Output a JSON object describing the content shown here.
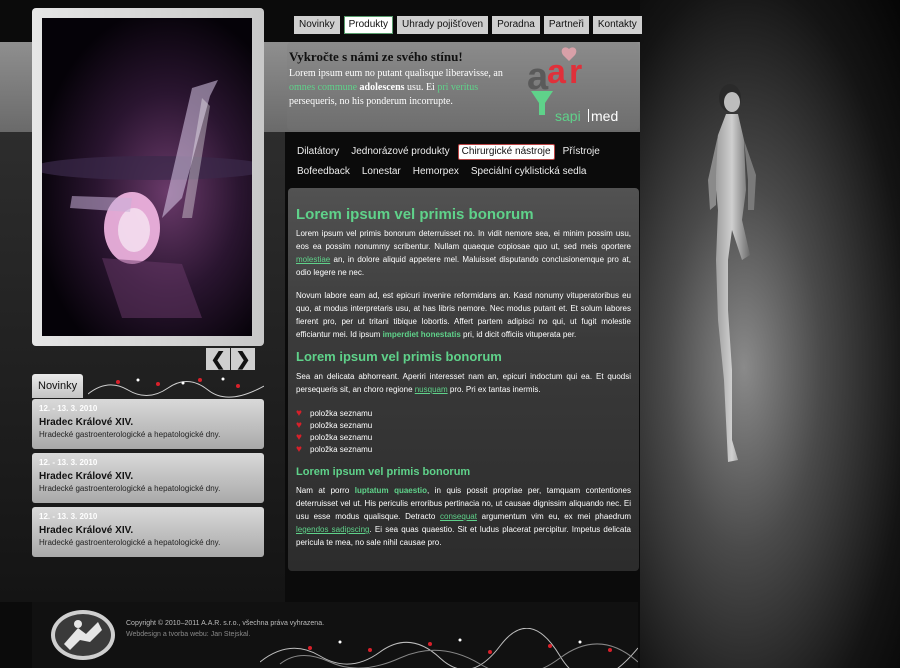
{
  "top_nav": [
    {
      "label": "Novinky",
      "active": false
    },
    {
      "label": "Produkty",
      "active": true
    },
    {
      "label": "Uhrady pojišťoven",
      "active": false
    },
    {
      "label": "Poradna",
      "active": false
    },
    {
      "label": "Partneři",
      "active": false
    },
    {
      "label": "Kontakty",
      "active": false
    }
  ],
  "header": {
    "title": "Vykročte s námi ze svého stínu!",
    "text_1": "Lorem ipsum eum no putant qualisque liberavisse, an ",
    "hl_1": "omnes commune",
    "bold_1": "adolescens",
    "text_2": " usu. Ei ",
    "hl_2": "pri veritus",
    "text_3": " persequeris, no his ponderum incorrupte."
  },
  "logo": {
    "word": "aar",
    "sub_1": "sapi",
    "sub_2": "med",
    "accent": "#e0303a",
    "green": "#5fd28a"
  },
  "category_nav": [
    {
      "label": "Dilatátory",
      "active": false
    },
    {
      "label": "Jednorázové produkty",
      "active": false
    },
    {
      "label": "Chirurgické nástroje",
      "active": true
    },
    {
      "label": "Přístroje",
      "active": false
    },
    {
      "label": "Bofeedback",
      "active": false
    },
    {
      "label": "Lonestar",
      "active": false
    },
    {
      "label": "Hemorpex",
      "active": false
    },
    {
      "label": "Speciální cyklistická sedla",
      "active": false
    }
  ],
  "content": {
    "h1": "Lorem ipsum vel primis bonorum",
    "p1_a": "Lorem ipsum vel primis bonorum deterruisset no. In vidit nemore sea, ei minim possim usu, eos ea possim nonummy scribentur. Nullam quaeque copiosae quo ut, sed meis oportere ",
    "p1_link": "molestiae",
    "p1_b": " an, in dolore aliquid appetere mel. Maluisset disputando conclusionemque pro at, odio legere ne nec.",
    "p2_a": "Novum labore eam ad, est epicuri invenire reformidans an. Kasd nonumy vituperatoribus eu quo, at modus interpretaris usu, at has libris nemore. Nec modus putant et. Et solum labores fierent pro, per ut tritani tibique lobortis. Affert partem adipisci no qui, ut fugit molestie efficiantur mei. Id ipsum ",
    "p2_bold": "imperdiet honestatis",
    "p2_b": " pri, id dicit officiis vituperata per.",
    "h2": "Lorem ipsum vel primis bonorum",
    "p3_a": "Sea an delicata abhorreant. Aperiri interesset nam an, epicuri indoctum qui ea. Et quodsi persequeris sit, an choro regione ",
    "p3_link": "nusquam",
    "p3_b": " pro. Pri ex tantas inermis.",
    "list": [
      "položka seznamu",
      "položka seznamu",
      "položka seznamu",
      "položka seznamu"
    ],
    "h3": "Lorem ipsum vel primis bonorum",
    "p4_a": "Nam at porro ",
    "p4_bold": "luptatum quaestio",
    "p4_b": ", in quis possit propriae per, tamquam contentiones deterruisset vel ut. His periculis erroribus pertinacia no, ut causae dignissim aliquando nec. Ei usu esse modus qualisque. Detracto ",
    "p4_link1": "consequat",
    "p4_c": " argumentum vim eu, ex mei phaedrum ",
    "p4_link2": "legendos sadipscing",
    "p4_d": ". Ei sea quas quaestio. Sit et ludus placerat percipitur. Impetus delicata pericula te mea, no sale nihil causae pro."
  },
  "news": {
    "tab_label": "Novinky",
    "items": [
      {
        "date": "12. - 13. 3. 2010",
        "title": "Hradec Králové XIV.",
        "desc": "Hradecké gastroenterologické a hepatologické dny."
      },
      {
        "date": "12. - 13. 3. 2010",
        "title": "Hradec Králové XIV.",
        "desc": "Hradecké gastroenterologické a hepatologické dny."
      },
      {
        "date": "12. - 13. 3. 2010",
        "title": "Hradec Králové XIV.",
        "desc": "Hradecké gastroenterologické a hepatologické dny."
      }
    ]
  },
  "slider": {
    "prev": "❮",
    "next": "❯"
  },
  "footer": {
    "copyright": "Copyright © 2010–2011 A.A.R. s.r.o., všechna práva vyhrazena.",
    "credit": "Webdesign a tvorba webu: Jan Stejskal."
  },
  "colors": {
    "accent_green": "#5fd28a",
    "heart_red": "#d8202a"
  }
}
